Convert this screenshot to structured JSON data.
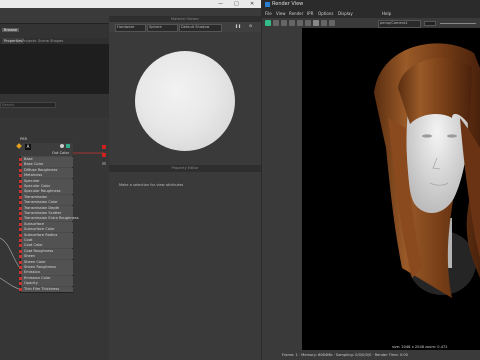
{
  "left_window": {
    "title_controls": [
      "—",
      "□",
      "✕"
    ],
    "tabs": [
      "Browse",
      "Projects",
      "Scene"
    ],
    "tab_labels_node_area": [
      "Properties",
      "Projects",
      "Scene Shapes"
    ],
    "search_placeholder": "Search"
  },
  "swatch": {
    "header": "Material Viewer",
    "dropdowns": [
      "Hardware",
      "Sphere",
      "Default Shadow"
    ]
  },
  "properties": {
    "header": "Property Editor",
    "empty_message": "Make a selection for view attributes"
  },
  "node": {
    "title": "PBR",
    "output_label": "Out Color",
    "ports": [
      "Base",
      "Base Color",
      "Diffuse Roughness",
      "Metalness",
      "Specular",
      "Specular Color",
      "Specular Roughness",
      "Transmission",
      "Transmission Color",
      "Transmission Depth",
      "Transmission Scatter",
      "Transmission Extra Roughness",
      "Subsurface",
      "Subsurface Color",
      "Subsurface Radius",
      "Coat",
      "Coat Color",
      "Coat Roughness",
      "Sheen",
      "Sheen Color",
      "Sheen Roughness",
      "Emission",
      "Emission Color",
      "Opacity",
      "Thin Film Thickness"
    ]
  },
  "render_view": {
    "title": "Render View",
    "menu": [
      "File",
      "View",
      "Render",
      "IPR",
      "Options",
      "Display",
      "Help"
    ],
    "camera_dropdown": "persp/Camera1",
    "status_line1": "size: 2048 x 2048 zoom: 0.472",
    "status_line2": "Frame: 1 · Memory: 6084Mb · Sampling: 0/0/0/0/0 · Render Time: 0:00"
  },
  "colors": {
    "hair": "#8a4a1e",
    "background": "#000000"
  }
}
